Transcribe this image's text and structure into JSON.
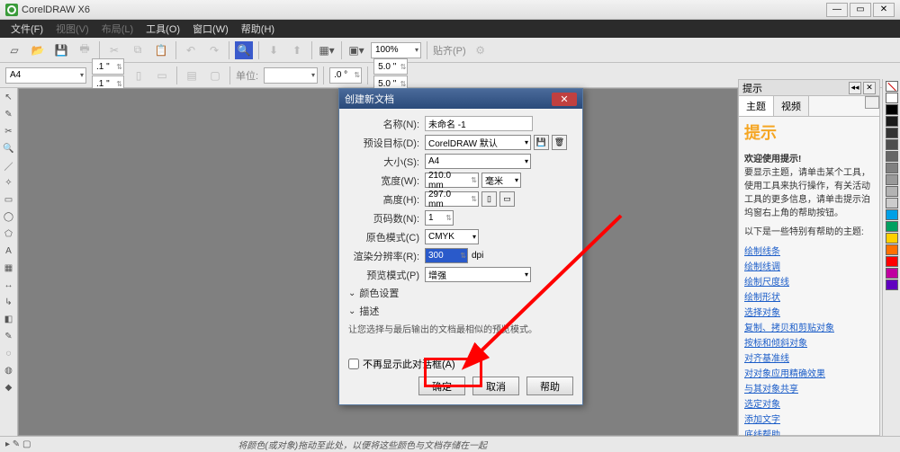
{
  "app": {
    "title": "CorelDRAW X6"
  },
  "menu": {
    "file": "文件(F)",
    "view": "视图(V)",
    "layout": "布局(L)",
    "tools": "工具(O)",
    "window": "窗口(W)",
    "help": "帮助(H)"
  },
  "toolbar": {
    "zoom": "100%",
    "paste": "贴齐(P)"
  },
  "props": {
    "pagesize": "A4",
    "offx": ".1 \"",
    "offy": ".1 \"",
    "units_label": "单位:",
    "angle": ".0 °",
    "snap": ".0 \"",
    "snapx": "5.0 \"",
    "snapy": "5.0 \""
  },
  "dialog": {
    "title": "创建新文档",
    "labels": {
      "name": "名称(N):",
      "preset": "预设目标(D):",
      "size": "大小(S):",
      "width": "宽度(W):",
      "height": "高度(H):",
      "pages": "页码数(N):",
      "colormode": "原色模式(C)",
      "resolution": "渲染分辨率(R):",
      "preview": "预览模式(P)"
    },
    "values": {
      "name": "未命名 -1",
      "preset": "CorelDRAW 默认",
      "size": "A4",
      "width": "210.0 mm",
      "width_unit": "毫米",
      "height": "297.0 mm",
      "pages": "1",
      "colormode": "CMYK",
      "resolution": "300",
      "res_unit": "dpi",
      "preview": "增强"
    },
    "color_section": "颜色设置",
    "desc_section": "描述",
    "desc_text": "让您选择与最后输出的文档最相似的预览模式。",
    "dontshow": "不再显示此对话框(A)",
    "ok": "确定",
    "cancel": "取消",
    "help": "帮助"
  },
  "hints": {
    "panel_title": "提示",
    "tab1": "主题",
    "tab2": "视频",
    "big": "提示",
    "welcome": "欢迎使用提示!",
    "body": "要显示主题，请单击某个工具，使用工具来执行操作，有关活动工具的更多信息，请单击提示泊坞窗右上角的帮助按钮。",
    "lead": "以下是一些特别有帮助的主题:",
    "links": [
      "绘制线条",
      "绘制线调",
      "绘制尺度线",
      "绘制形状",
      "选择对象",
      "复制、拷贝和剪贴对象",
      "按标和倾斜对象",
      "对齐基准线",
      "对对象应用精确效果",
      "与其对象共享",
      "选定对象",
      "添加文字",
      "底线帮助"
    ]
  },
  "swatches": [
    "#ffffff",
    "#000000",
    "#1a1a1a",
    "#333333",
    "#4d4d4d",
    "#666666",
    "#808080",
    "#999999",
    "#b3b3b3",
    "#cccccc",
    "#00a0e6",
    "#00a060",
    "#ffd000",
    "#ff7000",
    "#ff0000",
    "#c000a0",
    "#6000c0"
  ],
  "status": {
    "cursor": "▸ ✎ ▢",
    "hint": "将颜色(或对象)拖动至此处，以便将这些颜色与文档存储在一起"
  }
}
